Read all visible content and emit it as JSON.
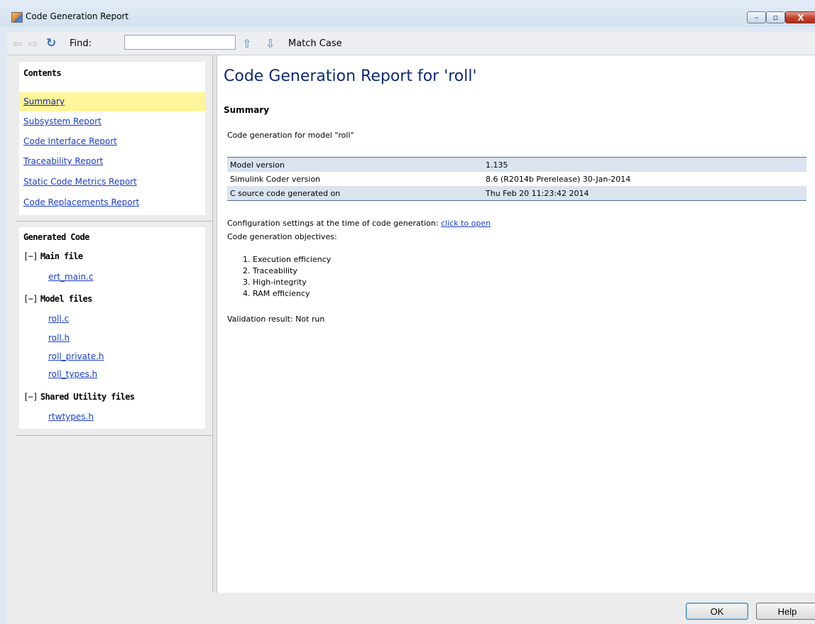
{
  "window": {
    "title": "Code Generation Report",
    "minimize": "–",
    "maximize": "▫",
    "close": "X"
  },
  "toolbar": {
    "back_icon": "⇦",
    "forward_icon": "⇨",
    "refresh_icon": "↻",
    "find_label": "Find:",
    "find_value": "",
    "find_up_icon": "⇧",
    "find_down_icon": "⇩",
    "match_case_label": "Match Case"
  },
  "sidebar": {
    "contents_heading": "Contents",
    "contents_items": [
      {
        "label": "Summary"
      },
      {
        "label": "Subsystem Report"
      },
      {
        "label": "Code Interface Report"
      },
      {
        "label": "Traceability Report"
      },
      {
        "label": "Static Code Metrics Report"
      },
      {
        "label": "Code Replacements Report"
      }
    ],
    "generated_code_heading": "Generated Code",
    "groups": [
      {
        "toggle": "[−]",
        "name": "Main file",
        "files": [
          "ert_main.c"
        ]
      },
      {
        "toggle": "[−]",
        "name": "Model files",
        "files": [
          "roll.c",
          "roll.h",
          "roll_private.h",
          "roll_types.h"
        ]
      },
      {
        "toggle": "[−]",
        "name": "Shared Utility files",
        "files": [
          "rtwtypes.h"
        ]
      }
    ]
  },
  "main": {
    "title": "Code Generation Report for 'roll'",
    "section": "Summary",
    "intro": "Code generation for model \"roll\"",
    "info_rows": [
      {
        "label": "Model version",
        "value": "1.135"
      },
      {
        "label": "Simulink Coder version",
        "value": "8.6 (R2014b Prerelease) 30-Jan-2014"
      },
      {
        "label": "C source code generated on",
        "value": "Thu Feb 20 11:23:42 2014"
      }
    ],
    "config_text": "Configuration settings at the time of code generation: ",
    "config_link": "click to open",
    "objectives_label": "Code generation objectives:",
    "objectives": [
      "Execution efficiency",
      "Traceability",
      "High-integrity",
      "RAM efficiency"
    ],
    "validation": "Validation result: Not run"
  },
  "buttons": {
    "ok": "OK",
    "help": "Help"
  },
  "colors": {
    "active_item": "#fff59a",
    "link": "#1a3ec8",
    "title": "#0d2a7a",
    "table_stripe": "#dae3ef"
  }
}
